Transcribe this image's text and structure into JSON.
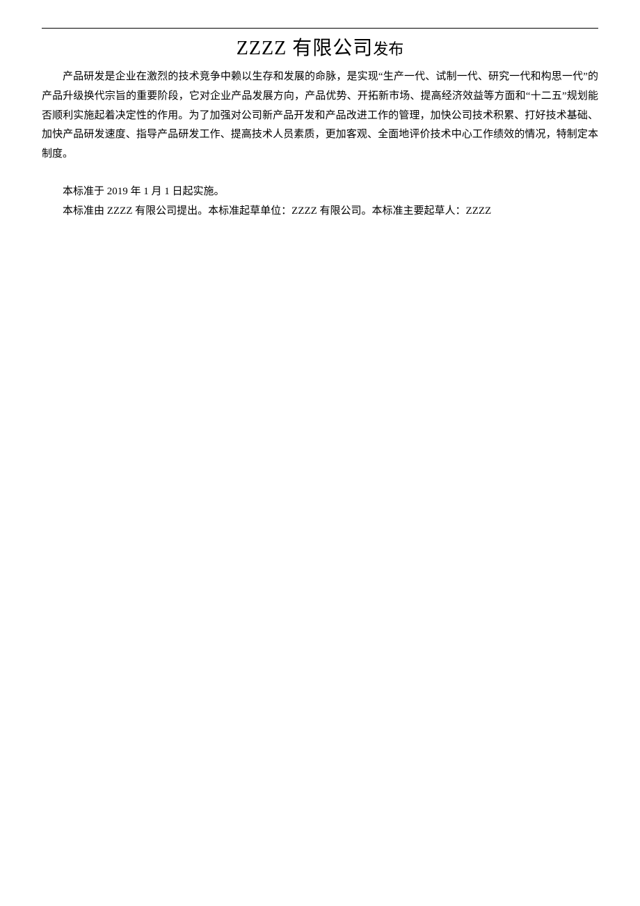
{
  "title": {
    "company": "ZZZZ 有限公司",
    "suffix": "发布"
  },
  "paragraph1": "产品研发是企业在激烈的技术竞争中赖以生存和发展的命脉，是实现“生产一代、试制一代、研究一代和构思一代”的产品升级换代宗旨的重要阶段，它对企业产品发展方向，产品优势、开拓新市场、提高经济效益等方面和“十二五”规划能否顺利实施起着决定性的作用。为了加强对公司新产品开发和产品改进工作的管理，加快公司技术积累、打好技术基础、加快产品研发速度、指导产品研发工作、提高技术人员素质，更加客观、全面地评价技术中心工作绩效的情况，特制定本制度。",
  "line1": "本标准于 2019 年 1 月 1 日起实施。",
  "line2": "本标准由 ZZZZ 有限公司提出。本标准起草单位：ZZZZ 有限公司。本标准主要起草人：ZZZZ"
}
